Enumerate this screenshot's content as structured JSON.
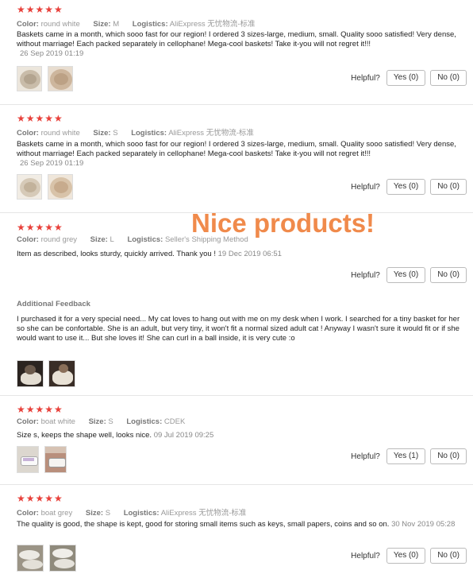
{
  "overlay_text": "Nice products!",
  "labels": {
    "color": "Color:",
    "size": "Size:",
    "logistics": "Logistics:",
    "helpful": "Helpful?",
    "additional_feedback": "Additional Feedback"
  },
  "reviews": [
    {
      "stars": "★★★★★",
      "color": "round white",
      "size": "M",
      "logistics": "AliExpress 无忧物流-标准",
      "text": "Baskets came in a month, which sooo fast for our region! I ordered 3 sizes-large, medium, small. Quality sooo satisfied! Very dense, without marriage! Each packed separately in cellophane! Mega-cool baskets! Take it-you will not regret it!!!",
      "date": "26 Sep 2019 01:19",
      "yes": "Yes (0)",
      "no": "No (0)"
    },
    {
      "stars": "★★★★★",
      "color": "round white",
      "size": "S",
      "logistics": "AliExpress 无忧物流-标准",
      "text": "Baskets came in a month, which sooo fast for our region! I ordered 3 sizes-large, medium, small. Quality sooo satisfied! Very dense, without marriage! Each packed separately in cellophane! Mega-cool baskets! Take it-you will not regret it!!!",
      "date": "26 Sep 2019 01:19",
      "yes": "Yes (0)",
      "no": "No (0)"
    },
    {
      "stars": "★★★★★",
      "color": "round grey",
      "size": "L",
      "logistics": "Seller's Shipping Method",
      "text": "Item as described, looks sturdy, quickly arrived. Thank you !",
      "date": "19 Dec 2019 06:51",
      "yes": "Yes (0)",
      "no": "No (0)",
      "feedback": "I purchased it for a very special need... My cat loves to hang out with me on my desk when I work. I searched for a tiny basket for her so she can be confortable. She is an adult, but very tiny, it won't fit a normal sized adult cat ! Anyway I wasn't sure it would fit or if she would want to use it... But she loves it! She can curl in a ball inside, it is very cute :o"
    },
    {
      "stars": "★★★★★",
      "color": "boat white",
      "size": "S",
      "logistics": "CDEK",
      "text": "Size s, keeps the shape well, looks nice.",
      "date": "09 Jul 2019 09:25",
      "yes": "Yes (1)",
      "no": "No (0)"
    },
    {
      "stars": "★★★★★",
      "color": "boat grey",
      "size": "S",
      "logistics": "AliExpress 无忧物流-标准",
      "text": "The quality is good, the shape is kept, good for storing small items such as keys, small papers, coins and so on.",
      "date": "30 Nov 2019 05:28",
      "yes": "Yes (0)",
      "no": "No (0)"
    }
  ]
}
